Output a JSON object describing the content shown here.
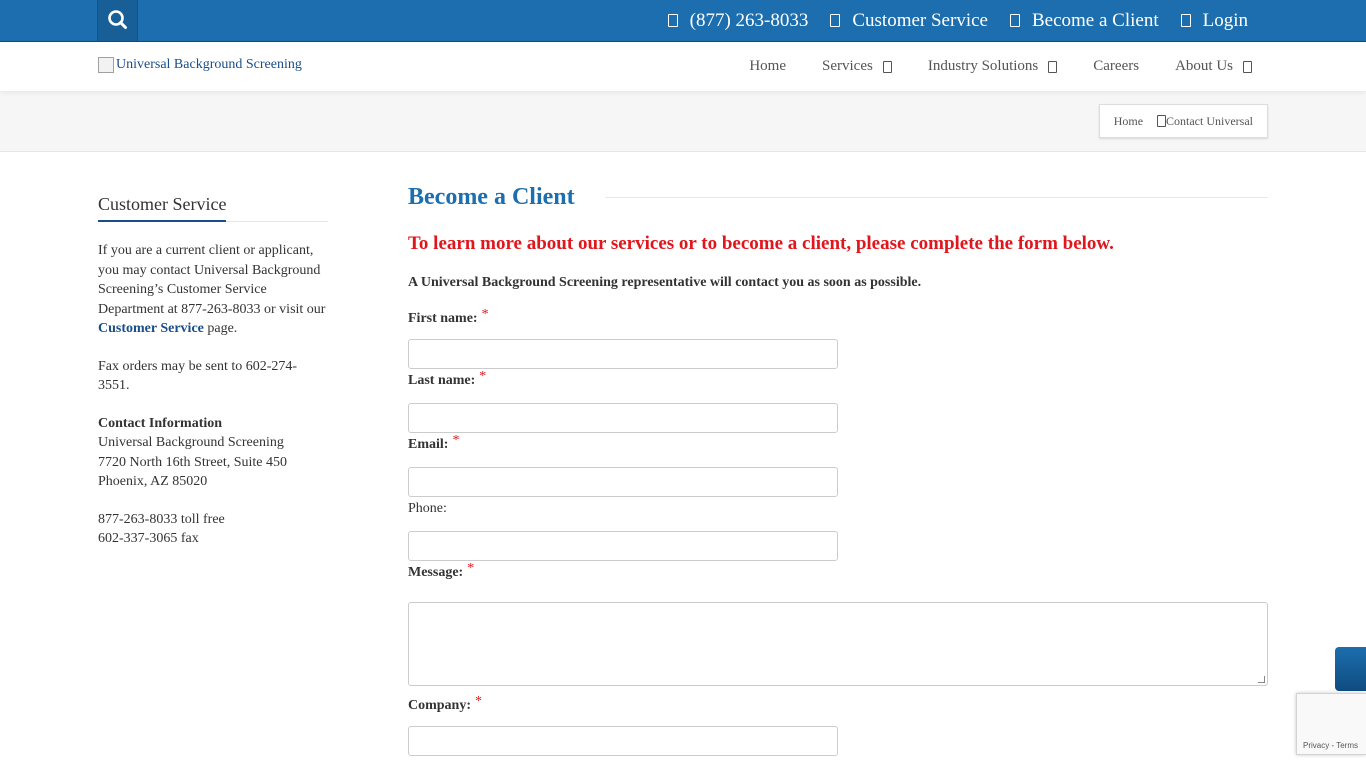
{
  "topbar": {
    "links": [
      {
        "label": "(877) 263-8033"
      },
      {
        "label": "Customer Service"
      },
      {
        "label": "Become a Client"
      },
      {
        "label": "Login"
      }
    ]
  },
  "header": {
    "logo_alt": "Universal Background Screening",
    "nav": [
      {
        "label": "Home"
      },
      {
        "label": "Services"
      },
      {
        "label": "Industry Solutions"
      },
      {
        "label": "Careers"
      },
      {
        "label": "About Us"
      }
    ]
  },
  "breadcrumb": {
    "home": "Home",
    "current": "Contact Universal"
  },
  "sidebar": {
    "title": "Customer Service",
    "intro": "If you are a current client or applicant, you may contact Universal Background Screening’s Customer Service Department at 877-263-8033 or visit our",
    "intro_link": "Customer Service",
    "intro_tail": " page.",
    "fax_note": "Fax orders may be sent to 602-274-3551.",
    "contact_heading": "Contact Information",
    "address": [
      "Universal Background Screening",
      "7720 North 16th Street, Suite 450",
      "Phoenix, AZ 85020"
    ],
    "phones": [
      "877-263-8033 toll free",
      "602-337-3065 fax"
    ]
  },
  "form": {
    "title": "Become a Client",
    "lead": "To learn more about our services or to become a client, please complete the form below.",
    "sub": "A Universal Background Screening representative will contact you as soon as possible.",
    "required_mark": "*",
    "fields": {
      "first_name": "First name:",
      "last_name": "Last name:",
      "email": "Email:",
      "phone": "Phone:",
      "message": "Message:",
      "company": "Company:"
    }
  },
  "recaptcha": {
    "privacy": "Privacy",
    "sep": " - ",
    "terms": "Terms"
  }
}
